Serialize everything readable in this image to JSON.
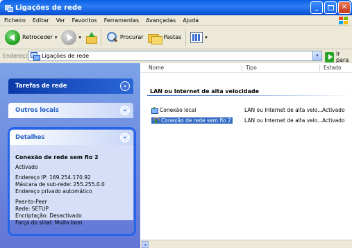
{
  "window": {
    "title": "Ligações de rede",
    "buttons": {
      "minimize": "_",
      "close": "✕"
    }
  },
  "menubar": {
    "items": [
      "Ficheiro",
      "Editar",
      "Ver",
      "Favoritos",
      "Ferramentas",
      "Avançadas",
      "Ajuda"
    ]
  },
  "toolbar": {
    "back_label": "Retroceder",
    "search_label": "Procurar",
    "folders_label": "Pastas",
    "dropdown_glyph": "▾"
  },
  "address": {
    "label": "Endereço",
    "value": "Ligações de rede",
    "go_label": "Ir para",
    "dropdown_glyph": "▾"
  },
  "tasks": {
    "network_tasks": "Tarefas de rede",
    "other_places": "Outros locais",
    "details": "Detalhes",
    "chevron_collapsed": "»",
    "chevron_expanded": "«"
  },
  "details": {
    "name": "Conexão de rede sem fio 2",
    "status": "Activado",
    "ip": "Endereço IP: 169.254.170.92",
    "mask": "Máscara de sub-rede: 255.255.0.0",
    "private": "Endereço privado automático",
    "mode": "Peer-to-Peer",
    "network": "Rede: SETUP",
    "encryption": "Encriptação: Desactivado",
    "signal": "Força do sinal: Muito bom"
  },
  "list": {
    "columns": {
      "name": "Nome",
      "type": "Tipo",
      "state": "Estado"
    },
    "group": "LAN ou Internet de alta velocidade",
    "rows": [
      {
        "name": "Conexão local",
        "type": "LAN ou Internet de alta velo...",
        "state": "Activado",
        "icon": "wired-connection-icon",
        "selected": false
      },
      {
        "name": "Conexão de rede sem fio 2",
        "type": "LAN ou Internet de alta velo...",
        "state": "Activado",
        "icon": "wireless-connection-icon",
        "selected": true
      }
    ]
  },
  "scrollbar": {
    "left_arrow": "◂"
  },
  "colors": {
    "titlebar": "#0a5fe6",
    "taskpane": "#6f8de0",
    "selection": "#316ac5",
    "focus_ring": "#2565ea"
  }
}
